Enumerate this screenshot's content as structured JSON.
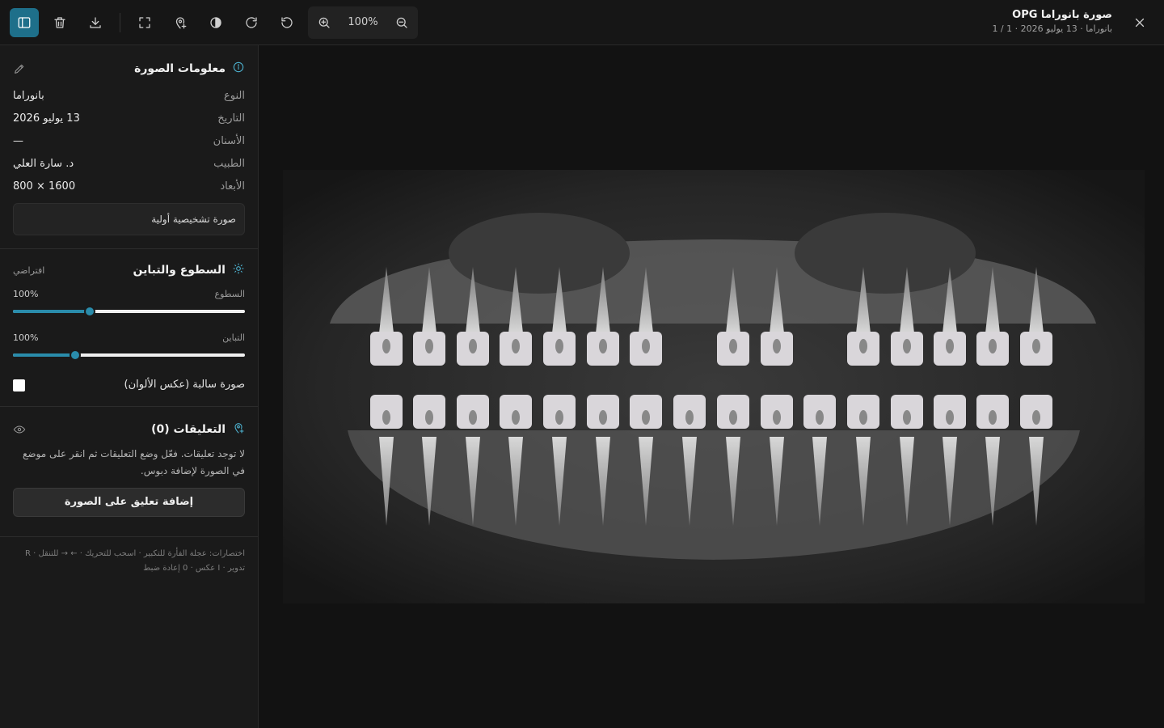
{
  "header": {
    "title": "صورة بانوراما OPG",
    "subtitle": "بانوراما · 13 يوليو 2026 · 1 / 1",
    "zoom": "100%"
  },
  "toolbar": {
    "icons": [
      "sidebar-toggle-icon",
      "trash-icon",
      "download-icon",
      "fit-screen-icon",
      "annotate-pin-icon",
      "invert-icon",
      "rotate-cw-icon",
      "rotate-ccw-icon",
      "zoom-in-icon",
      "zoom-out-icon",
      "close-icon"
    ],
    "accent": "#1e6f8a"
  },
  "info": {
    "title": "معلومات الصورة",
    "rows": [
      {
        "label": "النوع",
        "value": "بانوراما"
      },
      {
        "label": "التاريخ",
        "value": "13 يوليو 2026"
      },
      {
        "label": "الأسنان",
        "value": "—"
      },
      {
        "label": "الطبيب",
        "value": "د. سارة العلي"
      },
      {
        "label": "الأبعاد",
        "value": "1600 × 800"
      }
    ],
    "note": "صورة تشخيصية أولية"
  },
  "adjust": {
    "title": "السطوع والتباين",
    "reset": "افتراضي",
    "brightness_label": "السطوع",
    "brightness_value": "100%",
    "brightness_level": 0.33,
    "contrast_label": "التباين",
    "contrast_value": "100%",
    "contrast_level": 0.27,
    "invert_label": "صورة سالبة (عكس الألوان)",
    "invert_checked": false
  },
  "annotations": {
    "title": "التعليقات (0)",
    "empty": "لا توجد تعليقات. فعّل وضع التعليقات ثم انقر على موضع في الصورة لإضافة دبوس.",
    "add_button": "إضافة تعليق على الصورة"
  },
  "shortcuts": {
    "line1": "اختصارات: عجلة الفأرة للتكبير · اسحب للتحريك · ← → للتنقل · R",
    "line2": "تدوير · I عكس · 0 إعادة ضبط"
  }
}
